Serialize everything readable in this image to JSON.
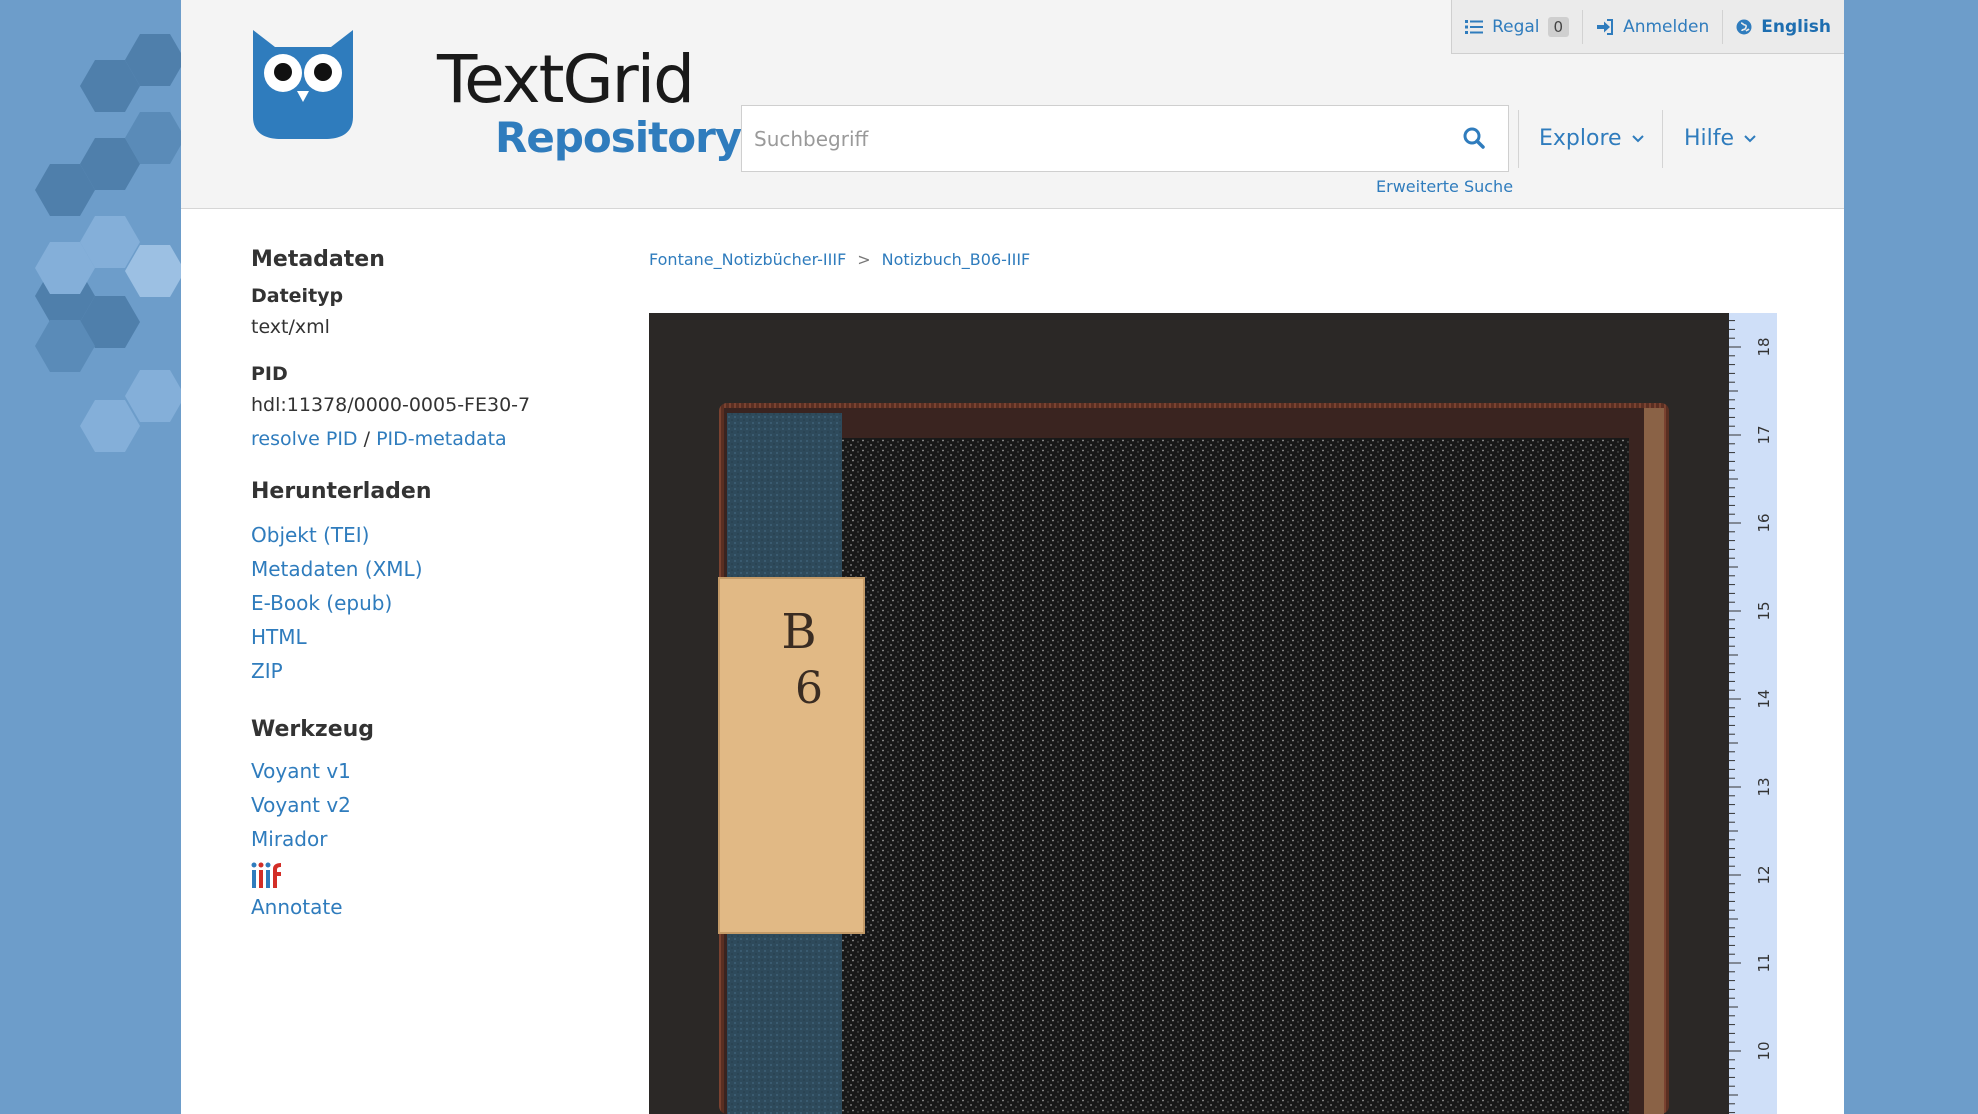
{
  "topbar": {
    "shelf_label": "Regal",
    "shelf_count": "0",
    "login_label": "Anmelden",
    "language_label": "English"
  },
  "logo": {
    "title": "TextGrid",
    "subtitle": "Repository"
  },
  "search": {
    "placeholder": "Suchbegriff",
    "advanced_label": "Erweiterte Suche"
  },
  "nav": {
    "explore_label": "Explore",
    "help_label": "Hilfe"
  },
  "sidebar": {
    "metadata_heading": "Metadaten",
    "filetype_label": "Dateityp",
    "filetype_value": "text/xml",
    "pid_label": "PID",
    "pid_value": "hdl:11378/0000-0005-FE30-7",
    "resolve_pid_label": "resolve PID",
    "pid_separator": "/",
    "pid_metadata_label": "PID-metadata",
    "download_heading": "Herunterladen",
    "downloads": [
      "Objekt (TEI)",
      "Metadaten (XML)",
      "E-Book (epub)",
      "HTML",
      "ZIP"
    ],
    "tools_heading": "Werkzeug",
    "tools": [
      "Voyant v1",
      "Voyant v2",
      "Mirador"
    ],
    "annotate_label": "Annotate"
  },
  "breadcrumb": {
    "items": [
      "Fontane_Notizbücher-IIIF",
      "Notizbuch_B06-IIIF"
    ],
    "separator": ">"
  },
  "viewer": {
    "label_line1": "B",
    "label_line2": "6",
    "ruler_labels": [
      "18",
      "17",
      "16",
      "15",
      "14",
      "13",
      "12",
      "11",
      "10"
    ]
  },
  "colors": {
    "accent": "#2f7cbd",
    "background": "#6d9dca",
    "header_bg": "#f4f4f4"
  }
}
